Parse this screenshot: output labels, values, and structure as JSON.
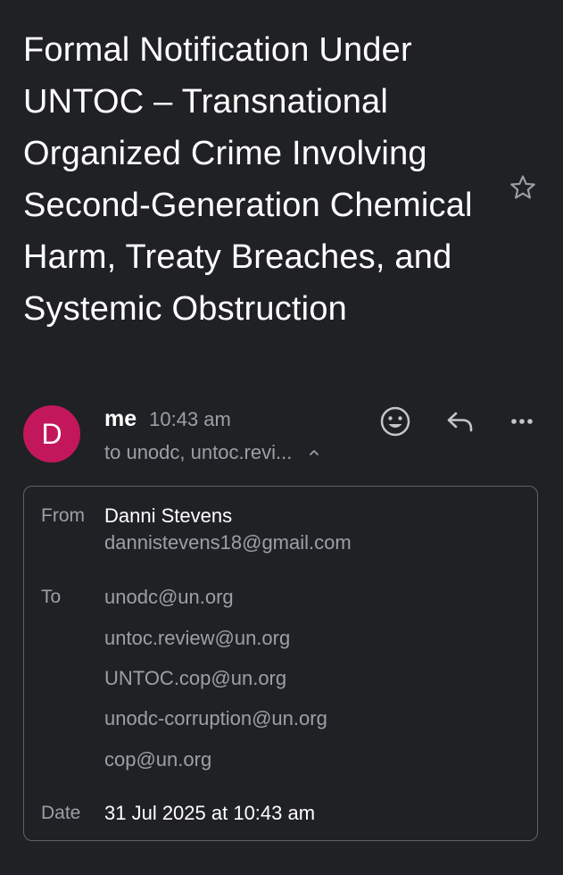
{
  "email": {
    "subject": "Formal Notification Under UNTOC – Transnational Organized Crime Involving Second-Generation Chemical Harm, Treaty Breaches, and Systemic Obstruction",
    "starred": false,
    "icons": {
      "star": "star-outline-icon",
      "react": "emoji-reaction-icon",
      "reply": "reply-icon",
      "more": "more-options-icon",
      "expand": "chevron-up-icon"
    },
    "sender": {
      "avatar_initial": "D",
      "avatar_color": "#c2185b",
      "display_name": "me",
      "time": "10:43 am",
      "recipients_summary": "to unodc, untoc.revi..."
    },
    "details": {
      "from_label": "From",
      "from_name": "Danni Stevens",
      "from_email": "dannistevens18@gmail.com",
      "to_label": "To",
      "to": [
        "unodc@un.org",
        "untoc.review@un.org",
        "UNTOC.cop@un.org",
        "unodc-corruption@un.org",
        "cop@un.org"
      ],
      "date_label": "Date",
      "date": "31 Jul 2025 at 10:43 am"
    }
  },
  "theme": {
    "background": "#202124",
    "text_primary": "#ffffff",
    "text_secondary": "#9aa0a6",
    "border": "#5f6368"
  }
}
